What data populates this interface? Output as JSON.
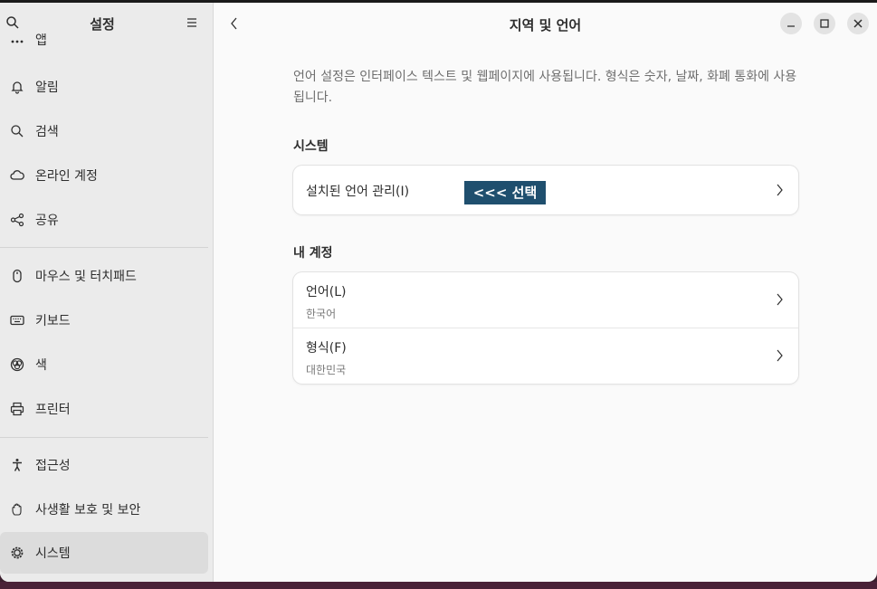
{
  "sidebar": {
    "title": "설정",
    "items": [
      {
        "label": "앱",
        "icon": "apps-icon"
      },
      {
        "label": "알림",
        "icon": "bell-icon"
      },
      {
        "label": "검색",
        "icon": "search-icon"
      },
      {
        "label": "온라인 계정",
        "icon": "cloud-icon"
      },
      {
        "label": "공유",
        "icon": "share-icon"
      },
      {
        "label": "마우스 및 터치패드",
        "icon": "mouse-icon"
      },
      {
        "label": "키보드",
        "icon": "keyboard-icon"
      },
      {
        "label": "색",
        "icon": "color-icon"
      },
      {
        "label": "프린터",
        "icon": "printer-icon"
      },
      {
        "label": "접근성",
        "icon": "accessibility-icon"
      },
      {
        "label": "사생활 보호 및 보안",
        "icon": "hand-icon"
      },
      {
        "label": "시스템",
        "icon": "system-gear-icon"
      }
    ]
  },
  "main": {
    "title": "지역 및 언어",
    "description": "언어 설정은 인터페이스 텍스트 및 웹페이지에 사용됩니다. 형식은 숫자, 날짜, 화폐 통화에 사용됩니다.",
    "system_section": {
      "title": "시스템",
      "row": {
        "label": "설치된 언어 관리(I)"
      }
    },
    "account_section": {
      "title": "내 계정",
      "rows": [
        {
          "label": "언어(L)",
          "value": "한국어"
        },
        {
          "label": "형식(F)",
          "value": "대한민국"
        }
      ]
    }
  },
  "annotation": {
    "label": "<<< 선택"
  },
  "colors": {
    "accent_tag": "#1f4f6e",
    "sidebar_bg": "#ebebeb",
    "selected_bg": "#dcdcdc"
  }
}
